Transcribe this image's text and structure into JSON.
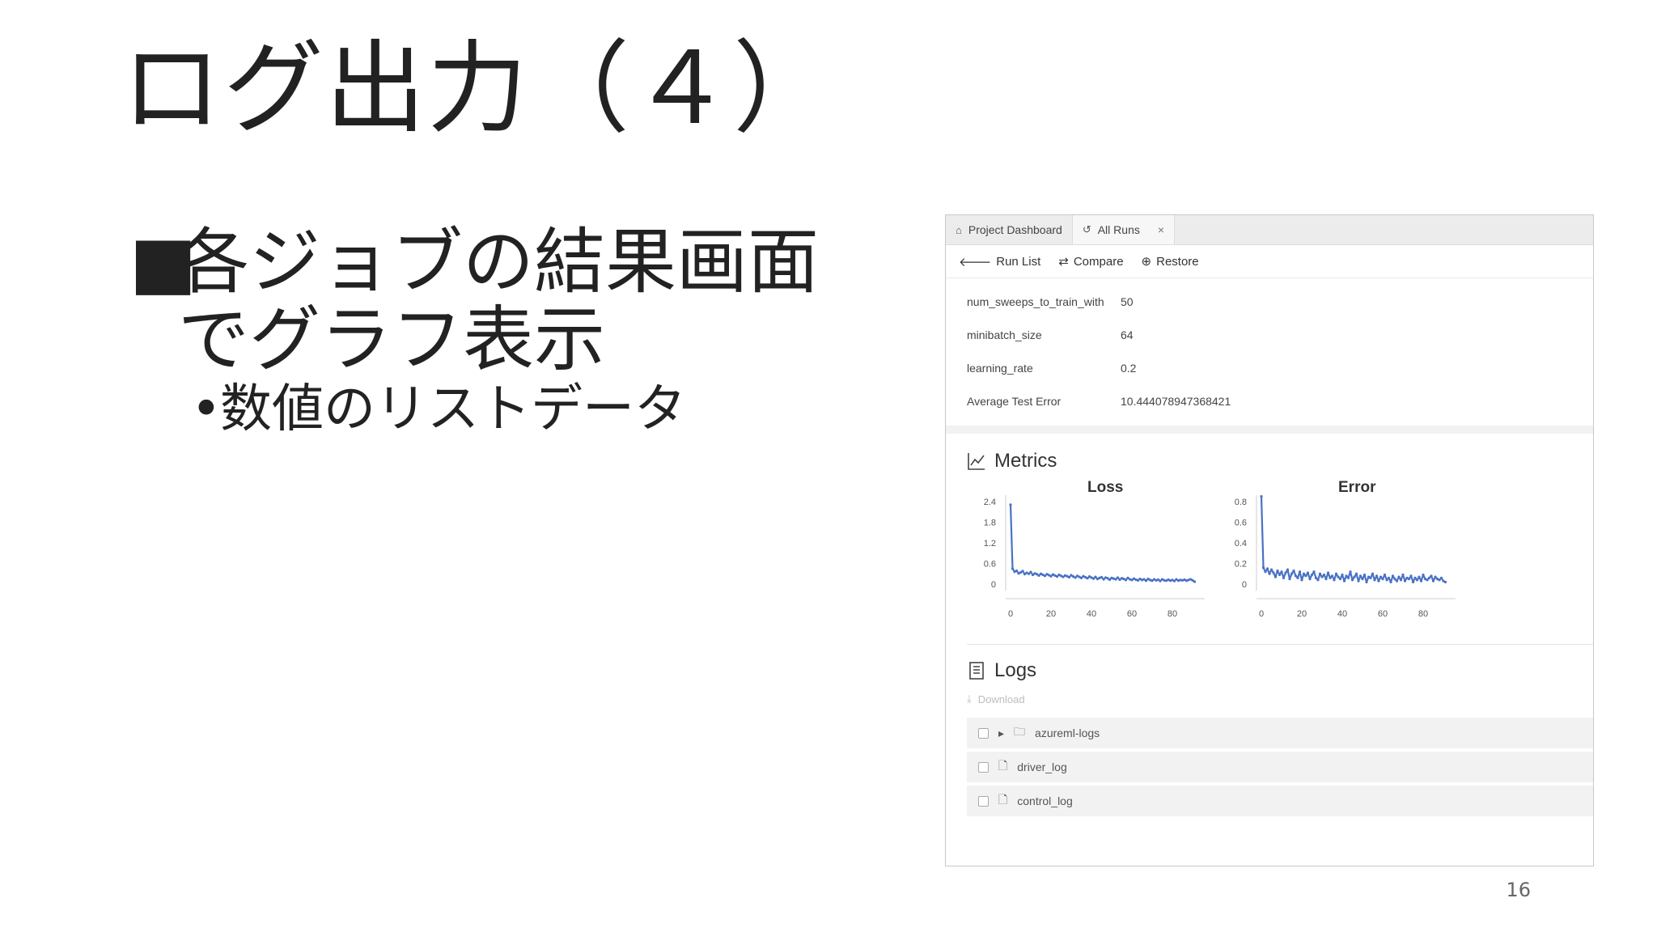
{
  "slide": {
    "title": "ログ出力（４）",
    "bullet_marker": "■",
    "bullet_main": "各ジョブの結果画面でグラフ表示",
    "bullet_sub_marker": "•",
    "bullet_sub": "数値のリストデータ",
    "page_number": "16"
  },
  "screenshot": {
    "tabs": [
      {
        "label": "Project Dashboard",
        "icon": "home-icon"
      },
      {
        "label": "All Runs",
        "icon": "history-icon",
        "close": "×"
      }
    ],
    "toolbar": {
      "run_list": "Run List",
      "compare": "Compare",
      "restore": "Restore"
    },
    "properties": [
      {
        "key": "num_sweeps_to_train_with",
        "value": "50"
      },
      {
        "key": "minibatch_size",
        "value": "64"
      },
      {
        "key": "learning_rate",
        "value": "0.2"
      },
      {
        "key": "Average Test Error",
        "value": "10.444078947368421"
      }
    ],
    "metrics_heading": "Metrics",
    "logs_heading": "Logs",
    "download_label": "Download",
    "log_items": [
      {
        "name": "azureml-logs",
        "type": "folder"
      },
      {
        "name": "driver_log",
        "type": "file"
      },
      {
        "name": "control_log",
        "type": "file"
      }
    ],
    "accent_color": "#4a72c4"
  },
  "chart_data": [
    {
      "type": "line",
      "title": "Loss",
      "xlabel": "",
      "ylabel": "",
      "x_ticks": [
        0,
        20,
        40,
        60,
        80
      ],
      "y_ticks": [
        0,
        0.6,
        1.2,
        1.8,
        2.4
      ],
      "xlim": [
        0,
        92
      ],
      "ylim": [
        0,
        2.4
      ],
      "x": [
        0,
        1,
        2,
        3,
        4,
        5,
        6,
        7,
        8,
        9,
        10,
        11,
        12,
        13,
        14,
        15,
        16,
        17,
        18,
        19,
        20,
        21,
        22,
        23,
        24,
        25,
        26,
        27,
        28,
        29,
        30,
        31,
        32,
        33,
        34,
        35,
        36,
        37,
        38,
        39,
        40,
        41,
        42,
        43,
        44,
        45,
        46,
        47,
        48,
        49,
        50,
        51,
        52,
        53,
        54,
        55,
        56,
        57,
        58,
        59,
        60,
        61,
        62,
        63,
        64,
        65,
        66,
        67,
        68,
        69,
        70,
        71,
        72,
        73,
        74,
        75,
        76,
        77,
        78,
        79,
        80,
        81,
        82,
        83,
        84,
        85,
        86,
        87,
        88,
        89,
        90,
        91
      ],
      "y": [
        2.31,
        0.45,
        0.36,
        0.39,
        0.31,
        0.34,
        0.38,
        0.29,
        0.33,
        0.3,
        0.35,
        0.27,
        0.31,
        0.29,
        0.25,
        0.3,
        0.27,
        0.24,
        0.29,
        0.26,
        0.23,
        0.28,
        0.25,
        0.22,
        0.27,
        0.24,
        0.21,
        0.25,
        0.23,
        0.2,
        0.26,
        0.22,
        0.19,
        0.24,
        0.21,
        0.18,
        0.23,
        0.2,
        0.17,
        0.22,
        0.19,
        0.16,
        0.21,
        0.15,
        0.18,
        0.2,
        0.14,
        0.19,
        0.17,
        0.13,
        0.18,
        0.16,
        0.14,
        0.19,
        0.13,
        0.17,
        0.15,
        0.12,
        0.18,
        0.14,
        0.12,
        0.16,
        0.13,
        0.11,
        0.15,
        0.12,
        0.14,
        0.1,
        0.15,
        0.12,
        0.1,
        0.14,
        0.11,
        0.13,
        0.09,
        0.14,
        0.11,
        0.1,
        0.13,
        0.1,
        0.12,
        0.09,
        0.14,
        0.1,
        0.12,
        0.11,
        0.13,
        0.1,
        0.12,
        0.14,
        0.11,
        0.07
      ],
      "color": "#4a72c4"
    },
    {
      "type": "line",
      "title": "Error",
      "xlabel": "",
      "ylabel": "",
      "x_ticks": [
        0,
        20,
        40,
        60,
        80
      ],
      "y_ticks": [
        0,
        0.2,
        0.4,
        0.6,
        0.8
      ],
      "xlim": [
        0,
        92
      ],
      "ylim": [
        0,
        0.8
      ],
      "x": [
        0,
        1,
        2,
        3,
        4,
        5,
        6,
        7,
        8,
        9,
        10,
        11,
        12,
        13,
        14,
        15,
        16,
        17,
        18,
        19,
        20,
        21,
        22,
        23,
        24,
        25,
        26,
        27,
        28,
        29,
        30,
        31,
        32,
        33,
        34,
        35,
        36,
        37,
        38,
        39,
        40,
        41,
        42,
        43,
        44,
        45,
        46,
        47,
        48,
        49,
        50,
        51,
        52,
        53,
        54,
        55,
        56,
        57,
        58,
        59,
        60,
        61,
        62,
        63,
        64,
        65,
        66,
        67,
        68,
        69,
        70,
        71,
        72,
        73,
        74,
        75,
        76,
        77,
        78,
        79,
        80,
        81,
        82,
        83,
        84,
        85,
        86,
        87,
        88,
        89,
        90,
        91
      ],
      "y": [
        0.85,
        0.16,
        0.12,
        0.15,
        0.1,
        0.14,
        0.11,
        0.07,
        0.13,
        0.09,
        0.12,
        0.06,
        0.11,
        0.14,
        0.05,
        0.1,
        0.13,
        0.08,
        0.06,
        0.12,
        0.04,
        0.1,
        0.08,
        0.11,
        0.05,
        0.09,
        0.12,
        0.06,
        0.04,
        0.1,
        0.07,
        0.09,
        0.05,
        0.11,
        0.06,
        0.08,
        0.04,
        0.1,
        0.07,
        0.05,
        0.09,
        0.03,
        0.08,
        0.06,
        0.12,
        0.04,
        0.07,
        0.1,
        0.03,
        0.08,
        0.05,
        0.09,
        0.02,
        0.07,
        0.06,
        0.1,
        0.04,
        0.08,
        0.03,
        0.07,
        0.05,
        0.09,
        0.04,
        0.06,
        0.02,
        0.08,
        0.05,
        0.03,
        0.07,
        0.04,
        0.09,
        0.03,
        0.06,
        0.05,
        0.08,
        0.02,
        0.06,
        0.04,
        0.07,
        0.03,
        0.09,
        0.05,
        0.04,
        0.06,
        0.08,
        0.03,
        0.07,
        0.05,
        0.04,
        0.06,
        0.03,
        0.02
      ],
      "color": "#4a72c4"
    }
  ]
}
